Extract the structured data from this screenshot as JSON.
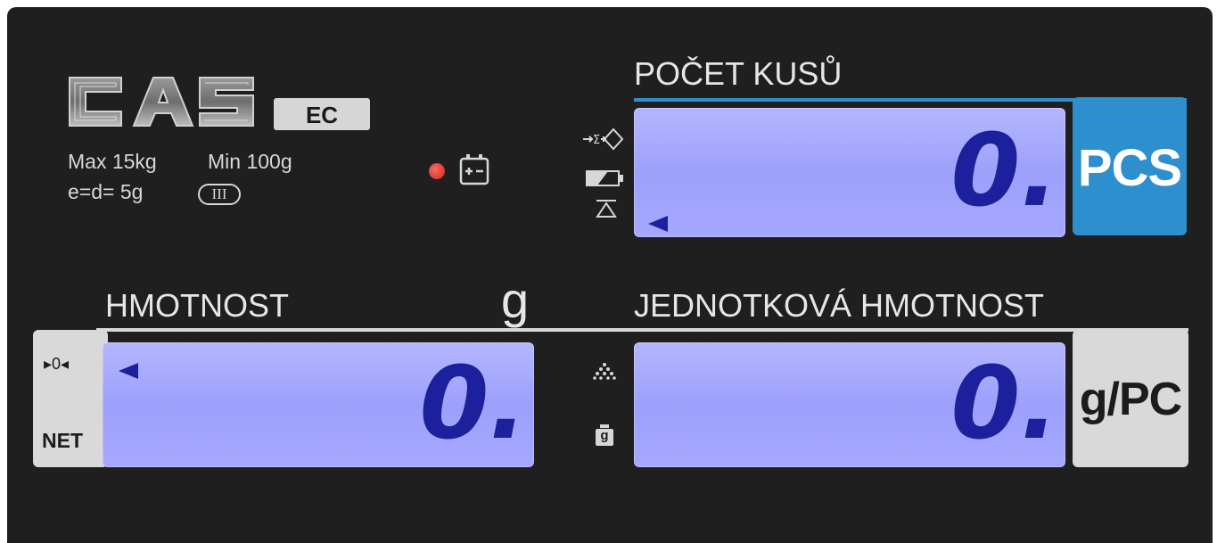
{
  "brand": {
    "logo_text": "CAS",
    "model_badge": "EC"
  },
  "specs": {
    "max": "Max 15kg",
    "min": "Min 100g",
    "division": "e=d= 5g",
    "accuracy_class": "III"
  },
  "indicators": {
    "power_led_color": "#e53935",
    "battery_icon": "battery-charge-icon"
  },
  "count_display": {
    "title": "POČET KUSŮ",
    "value": "0.",
    "unit_label": "PCS",
    "icons": [
      "accumulate-sum-icon",
      "low-battery-icon",
      "stable-icon"
    ]
  },
  "weight_display": {
    "title": "HMOTNOST",
    "unit": "g",
    "value": "0.",
    "zero_label": "▸0◂",
    "net_label": "NET"
  },
  "unit_weight_display": {
    "title": "JEDNOTKOVÁ HMOTNOST",
    "value": "0.",
    "unit_label": "g/PC",
    "side_icons": [
      "sample-dots-icon",
      "weight-g-icon"
    ],
    "weight_icon_letter": "g"
  },
  "colors": {
    "panel": "#1f1f1f",
    "lcd": "#a3a5fd",
    "lcd_digits": "#1d209c",
    "pcs_blue": "#2d8fcd",
    "label_grey": "#d9d9d9"
  }
}
